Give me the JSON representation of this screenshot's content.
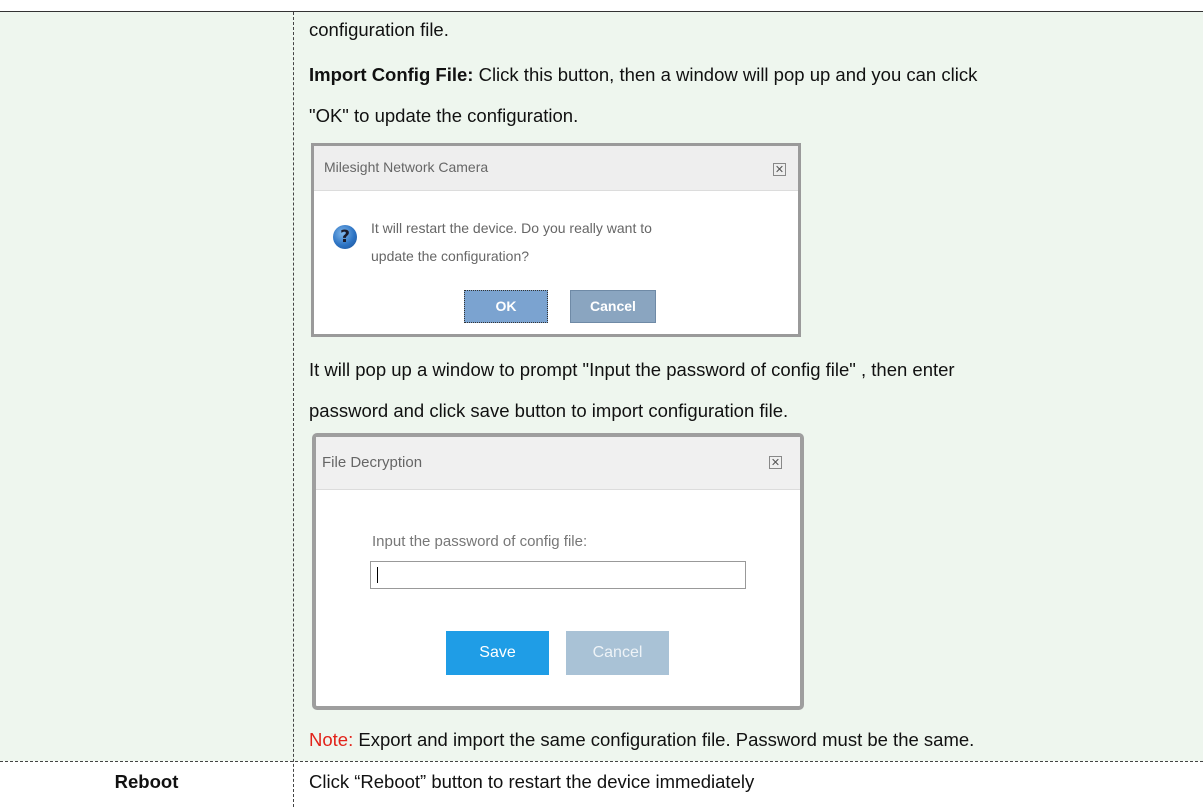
{
  "doc": {
    "line1": "configuration file.",
    "import_label": "Import Config File:",
    "import_text": " Click this button, then a window will pop up and you can click",
    "line3": "\"OK\" to update the configuration.",
    "line4": "It will pop up a window to prompt \"Input the password of config file\" , then enter",
    "line5": "password and click save button to import configuration file.",
    "note_label": "Note:",
    "note_text": " Export and import the same configuration file. Password must be the same.",
    "reboot_label": "Reboot",
    "reboot_text": "Click “Reboot” button to restart the device immediately"
  },
  "dialog1": {
    "title": "Milesight Network Camera",
    "close": "✕",
    "icon": "question-icon",
    "icon_glyph": "?",
    "message_line1": "It will restart the device. Do you really want to",
    "message_line2": "update the configuration?",
    "ok_label": "OK",
    "cancel_label": "Cancel"
  },
  "dialog2": {
    "title": "File Decryption",
    "close": "✕",
    "label": "Input the password of config file:",
    "input_value": "",
    "save_label": "Save",
    "cancel_label": "Cancel"
  },
  "colors": {
    "row_bg": "#eef6ee",
    "note_red": "#e2231a",
    "save_blue": "#1f9de6"
  }
}
